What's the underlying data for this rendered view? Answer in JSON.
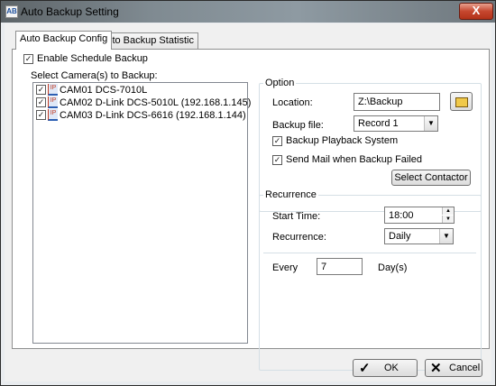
{
  "window": {
    "title": "Auto Backup Setting",
    "app_icon": "AB",
    "close_glyph": "X"
  },
  "tabs": [
    {
      "label": "Auto Backup Config",
      "active": true
    },
    {
      "label": "Auto Backup Statistic",
      "active": false
    }
  ],
  "enable_schedule": {
    "label": "Enable Schedule Backup",
    "checked": true
  },
  "camera_list": {
    "label": "Select Camera(s) to Backup:",
    "items": [
      {
        "text": "CAM01  DCS-7010L",
        "checked": true,
        "icon": "ip-camera-icon",
        "icon_text": "IP"
      },
      {
        "text": "CAM02  D-Link DCS-5010L (192.168.1.145)",
        "checked": true,
        "icon": "ip-camera-icon",
        "icon_text": "IP"
      },
      {
        "text": "CAM03  D-Link DCS-6616 (192.168.1.144)",
        "checked": true,
        "icon": "ip-camera-icon",
        "icon_text": "IP"
      }
    ]
  },
  "option": {
    "title": "Option",
    "location_label": "Location:",
    "location_value": "Z:\\Backup",
    "browse_icon": "folder-open-icon",
    "backup_file_label": "Backup file:",
    "backup_file_value": "Record 1",
    "playback_label": "Backup Playback System",
    "playback_checked": true,
    "sendmail_label": "Send Mail when Backup Failed",
    "sendmail_checked": true,
    "select_contactor": "Select Contactor"
  },
  "recurrence": {
    "title": "Recurrence",
    "start_time_label": "Start Time:",
    "start_time_value": "18:00",
    "recurrence_label": "Recurrence:",
    "recurrence_value": "Daily",
    "every_label": "Every",
    "every_value": "7",
    "unit_label": "Day(s)"
  },
  "buttons": {
    "ok": "OK",
    "ok_icon": "checkmark-icon",
    "cancel": "Cancel",
    "cancel_icon": "x-icon"
  },
  "glyphs": {
    "check": "✓",
    "dropdown": "▼",
    "spin_up": "▲",
    "spin_down": "▼"
  }
}
